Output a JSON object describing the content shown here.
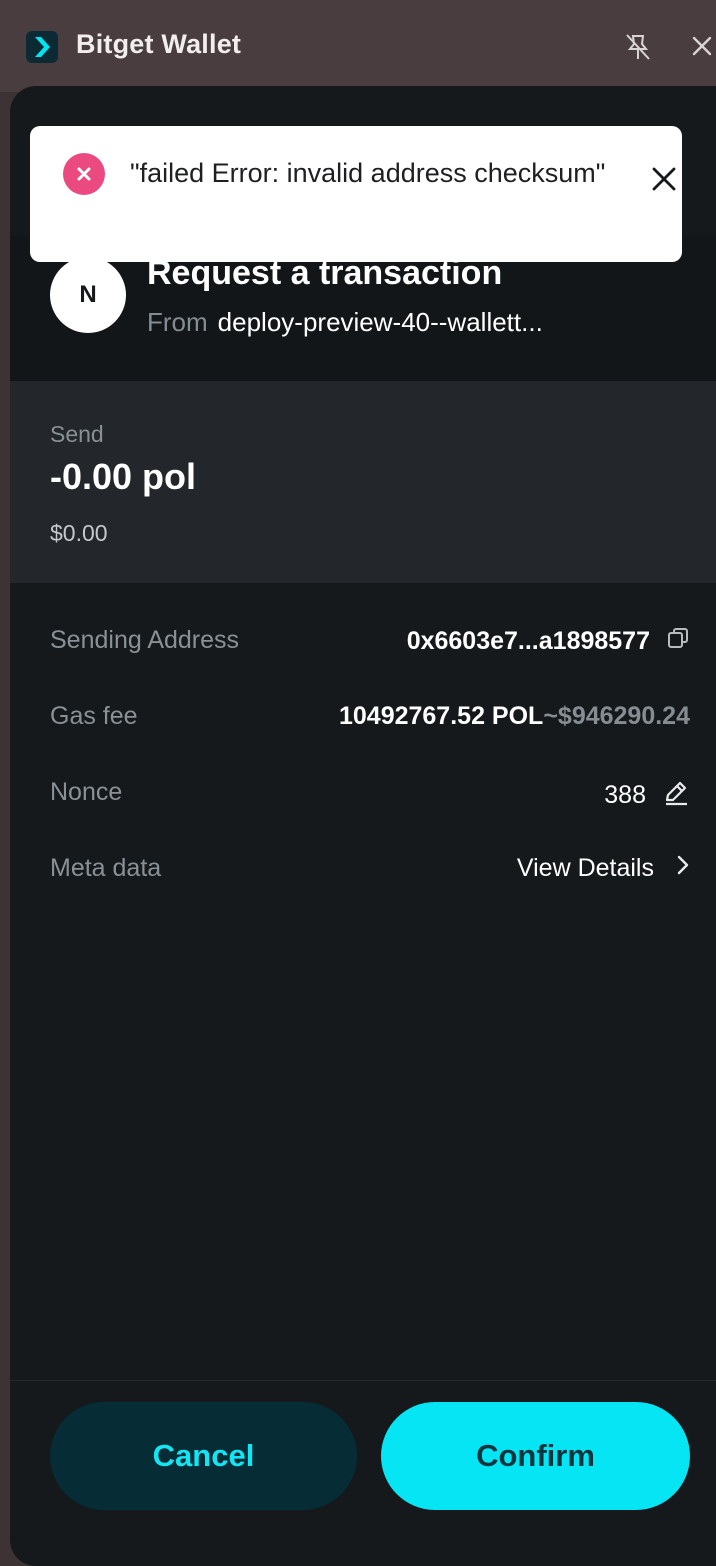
{
  "window": {
    "title": "Bitget Wallet",
    "logo_icon": "bitget-chevron-icon",
    "pin_icon": "unpin-icon",
    "close_icon": "close-icon"
  },
  "toast": {
    "message": "\"failed Error: invalid address checksum\"",
    "status_icon": "error-x-icon",
    "close_icon": "close-icon",
    "accent_color": "#ea4a7f"
  },
  "request": {
    "avatar_letter": "N",
    "title": "Request a transaction",
    "from_label": "From",
    "from_value": "deploy-preview-40--wallett..."
  },
  "send": {
    "label": "Send",
    "amount": "-0.00 pol",
    "usd": "$0.00"
  },
  "details": {
    "sending_address": {
      "label": "Sending Address",
      "value": "0x6603e7...a1898577",
      "icon": "copy-icon"
    },
    "gas_fee": {
      "label": "Gas fee",
      "value": "10492767.52 POL",
      "usd": "~$946290.24"
    },
    "nonce": {
      "label": "Nonce",
      "value": "388",
      "icon": "edit-pencil-icon"
    },
    "meta_data": {
      "label": "Meta data",
      "value": "View Details",
      "icon": "chevron-right-icon"
    }
  },
  "actions": {
    "cancel_label": "Cancel",
    "confirm_label": "Confirm"
  },
  "colors": {
    "accent": "#06e5f4",
    "background": "#15191c",
    "send_box": "#23262a",
    "error": "#ea4a7f"
  }
}
